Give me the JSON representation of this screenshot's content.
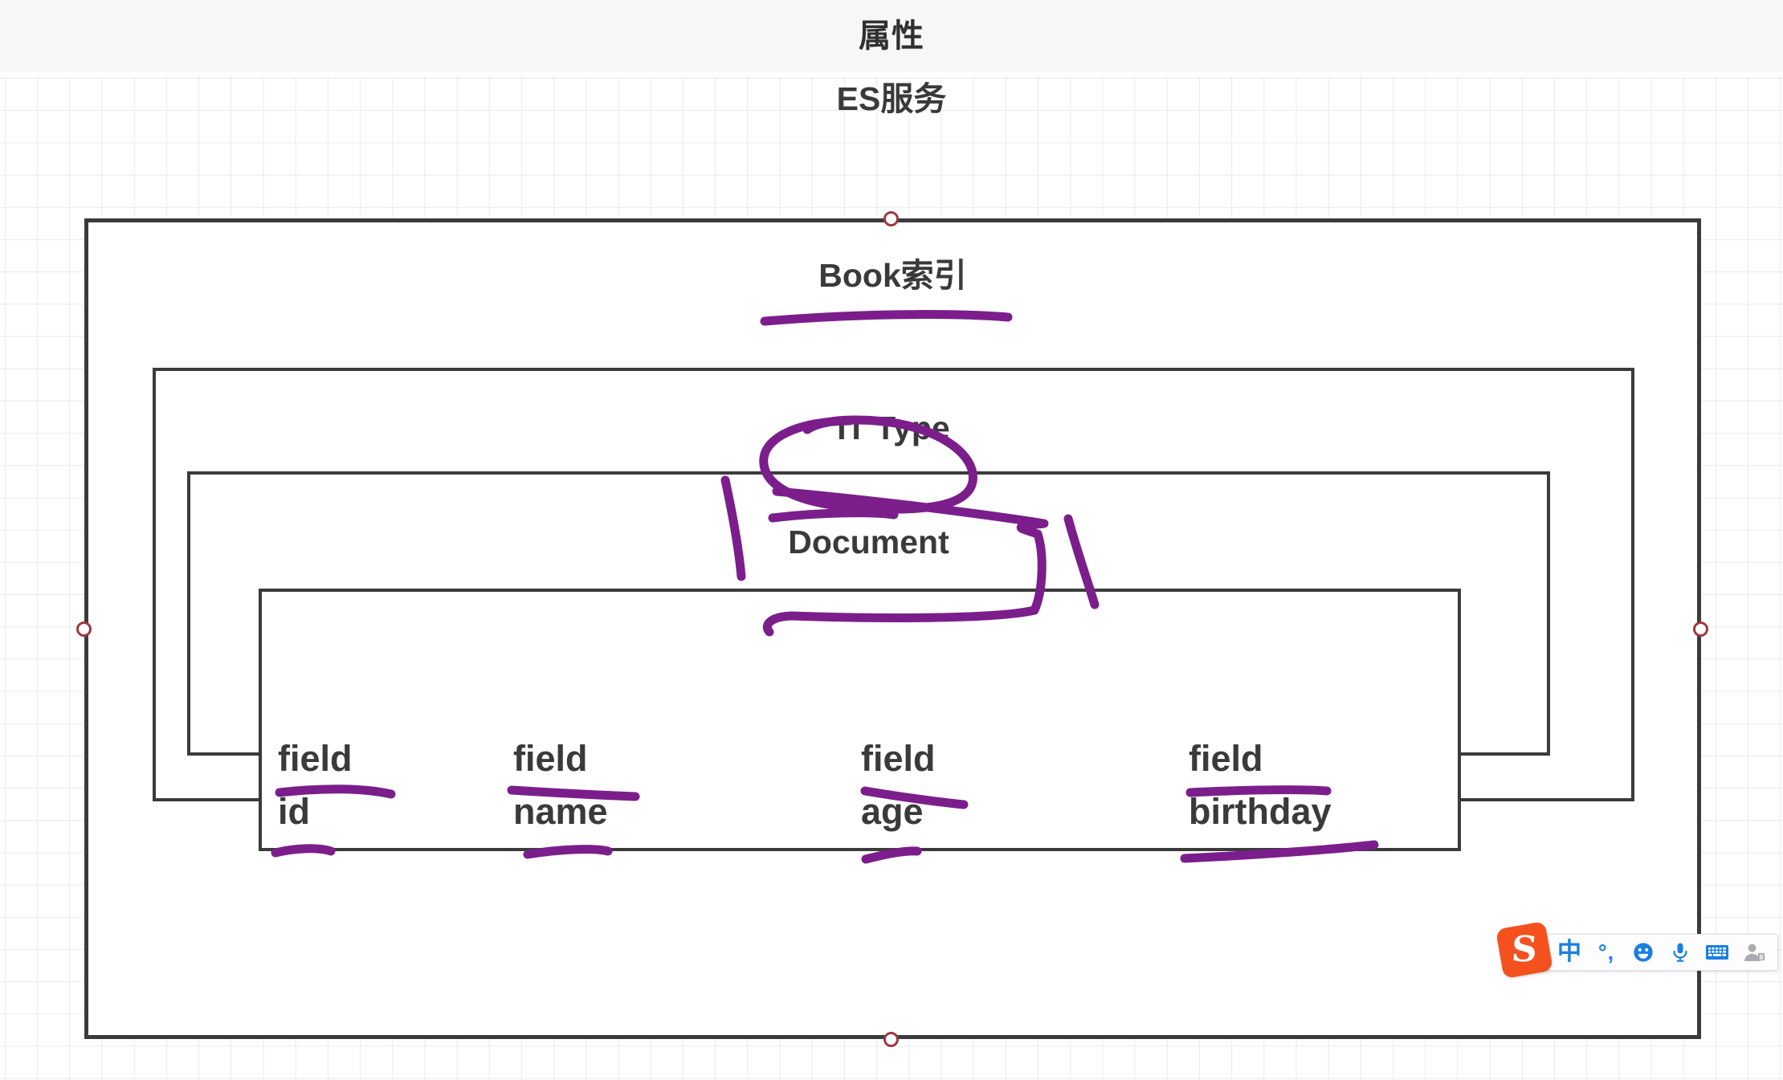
{
  "header": {
    "title": "属性"
  },
  "diagram": {
    "service_title": "ES服务",
    "index_title": "Book索引",
    "type_title": "IT Type",
    "document_title": "Document",
    "fields": [
      {
        "label": "field",
        "name": "id"
      },
      {
        "label": "field",
        "name": "name"
      },
      {
        "label": "field",
        "name": "age"
      },
      {
        "label": "field",
        "name": "birthday"
      }
    ],
    "ink_color": "#7b1e8c",
    "shape_border_color": "#3b3b3b",
    "handle_color": "#9c3a42"
  },
  "ime": {
    "logo_letter": "S",
    "mode_label": "中",
    "punctuation_label": "°,",
    "icons": [
      "sogou-logo-icon",
      "chinese-mode-icon",
      "punctuation-icon",
      "emoji-icon",
      "voice-input-icon",
      "soft-keyboard-icon",
      "user-account-icon"
    ]
  }
}
